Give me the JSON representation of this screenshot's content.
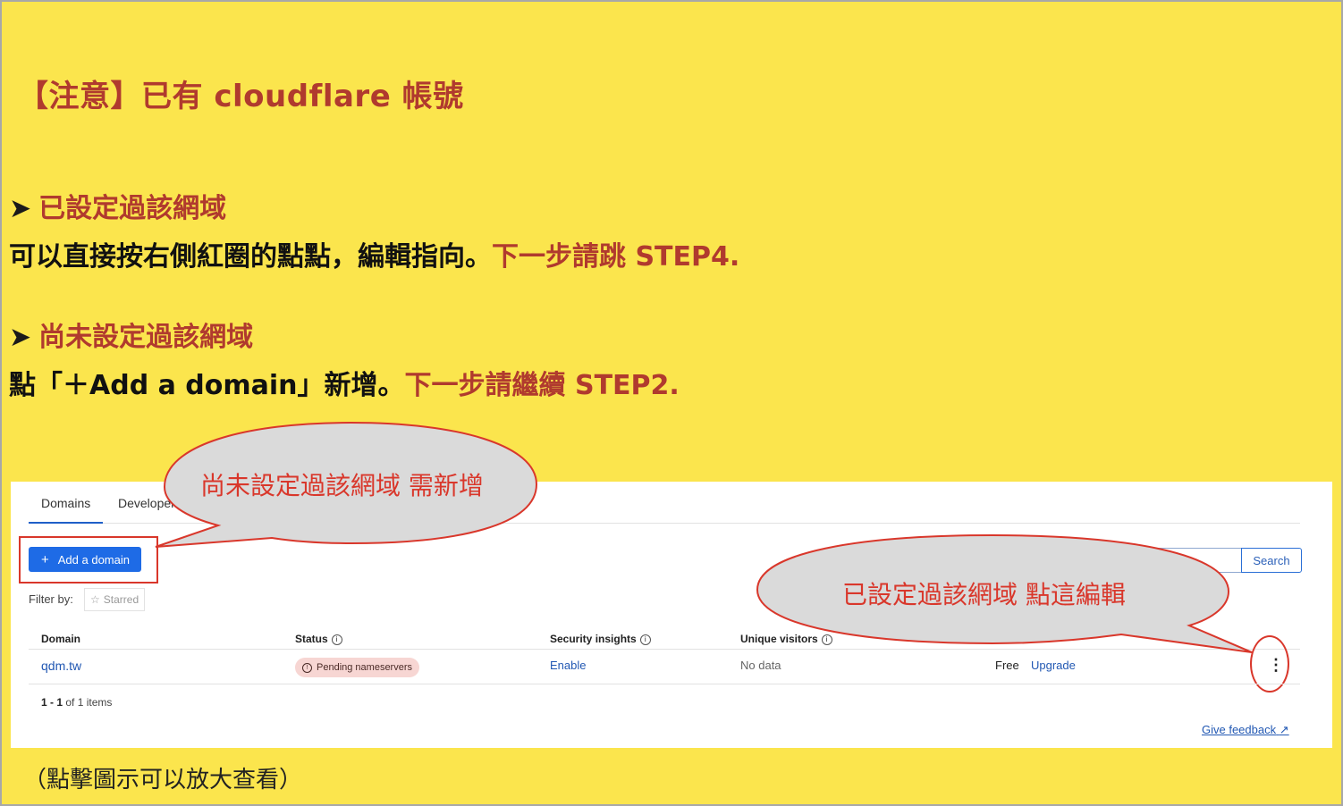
{
  "header": {
    "title": "【注意】已有 cloudflare 帳號"
  },
  "section1": {
    "heading": "已設定過該網域",
    "body_black": "可以直接按右側紅圈的點點，編輯指向。",
    "body_red": "下一步請跳 STEP4."
  },
  "section2": {
    "heading": "尚未設定過該網域",
    "body_black": "點「＋Add a domain」新增。",
    "body_red": "下一步請繼續 STEP2."
  },
  "bullet_glyph": "➤",
  "footer_note": "（點擊圖示可以放大查看）",
  "screenshot": {
    "tabs": [
      {
        "label": "Domains",
        "active": true
      },
      {
        "label": "Developer",
        "active": false
      }
    ],
    "add_button": "Add a domain",
    "search_button": "Search",
    "filter_label": "Filter by:",
    "starred_chip": "Starred",
    "table": {
      "headers": [
        "Domain",
        "Status",
        "Security insights",
        "Unique visitors"
      ],
      "rows": [
        {
          "domain": "qdm.tw",
          "status": "Pending nameservers",
          "security": "Enable",
          "visitors": "No data",
          "plan": "Free",
          "plan_action": "Upgrade"
        }
      ]
    },
    "pager": {
      "range": "1 - 1",
      "rest": "of 1 items"
    },
    "feedback_link": "Give feedback"
  },
  "callouts": {
    "left": "尚未設定過該網域 需新增",
    "right": "已設定過該網域 點這編輯"
  },
  "colors": {
    "background": "#fbe54d",
    "accent_red": "#b03a2e",
    "annotation_red": "#d9372b",
    "primary_blue": "#1e6be6"
  }
}
